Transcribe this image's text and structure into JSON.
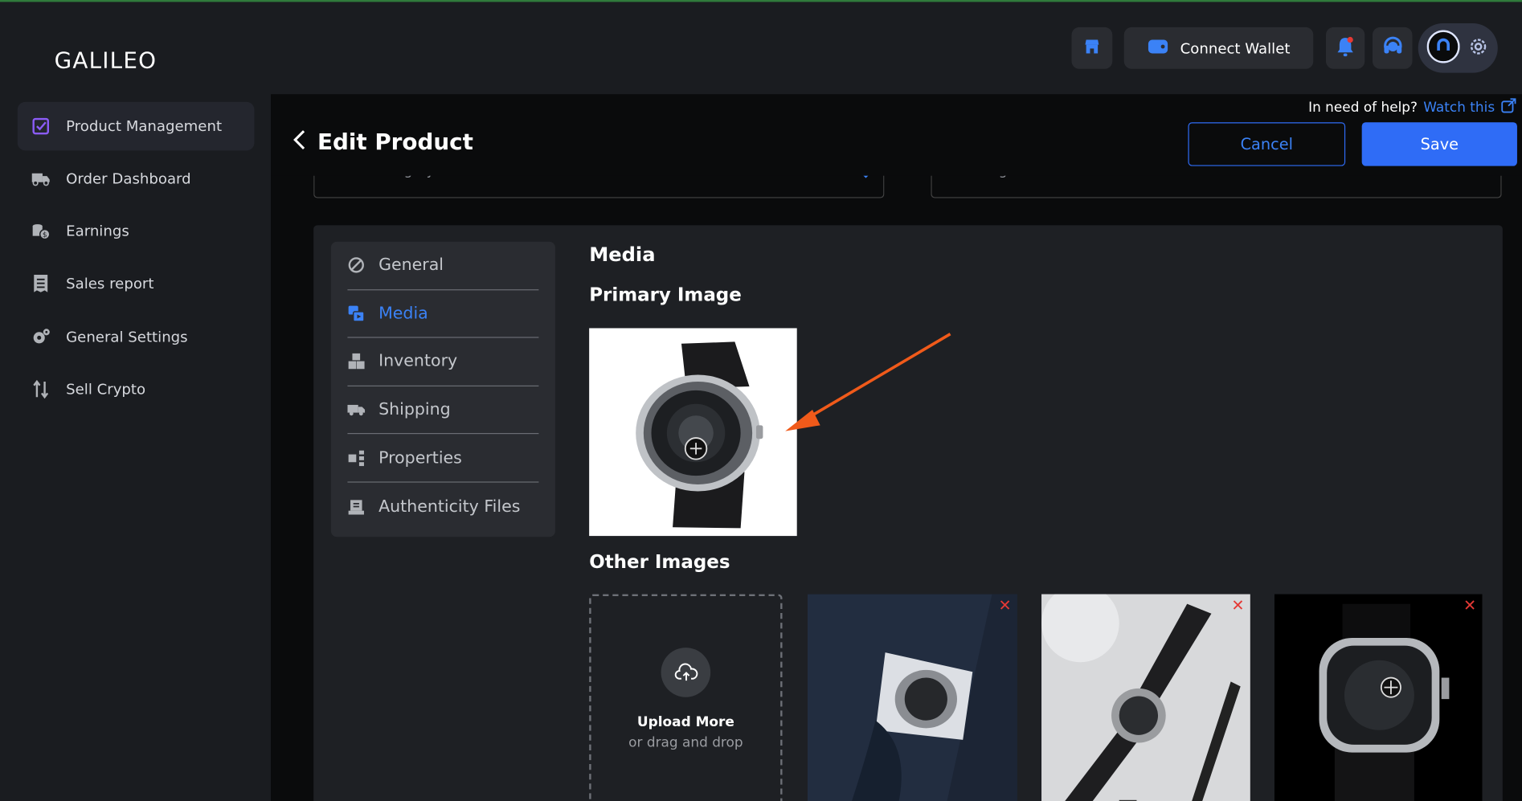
{
  "app": {
    "logo": "GALILEO"
  },
  "sidebar": {
    "items": [
      {
        "label": "Product Management",
        "icon": "checklist-icon",
        "active": true
      },
      {
        "label": "Order Dashboard",
        "icon": "truck-icon"
      },
      {
        "label": "Earnings",
        "icon": "coins-icon"
      },
      {
        "label": "Sales report",
        "icon": "receipt-icon"
      },
      {
        "label": "General Settings",
        "icon": "gear-icon"
      },
      {
        "label": "Sell Crypto",
        "icon": "swap-arrows-icon"
      }
    ]
  },
  "topbar": {
    "connect_wallet": "Connect Wallet",
    "icons": [
      "store-icon",
      "wallet-icon",
      "bell-icon",
      "headset-icon",
      "profile-icon",
      "gear-icon"
    ]
  },
  "help": {
    "text": "In need of help?",
    "link": "Watch this"
  },
  "page": {
    "title": "Edit Product",
    "cancel": "Cancel",
    "save": "Save",
    "category_placeholder": "Select Category",
    "tags_placeholder": "Enter Tags"
  },
  "tabs": [
    {
      "label": "General",
      "icon": "general-icon"
    },
    {
      "label": "Media",
      "icon": "media-icon",
      "active": true
    },
    {
      "label": "Inventory",
      "icon": "inventory-icon"
    },
    {
      "label": "Shipping",
      "icon": "shipping-icon"
    },
    {
      "label": "Properties",
      "icon": "properties-icon"
    },
    {
      "label": "Authenticity Files",
      "icon": "authenticity-icon"
    }
  ],
  "media": {
    "heading": "Media",
    "primary_heading": "Primary Image",
    "other_heading": "Other Images",
    "upload_title": "Upload More",
    "upload_sub": "or drag and drop",
    "remove_glyph": "✕"
  },
  "colors": {
    "accent": "#2f6cf6",
    "arrow": "#f05a1a",
    "danger": "#e53935"
  }
}
